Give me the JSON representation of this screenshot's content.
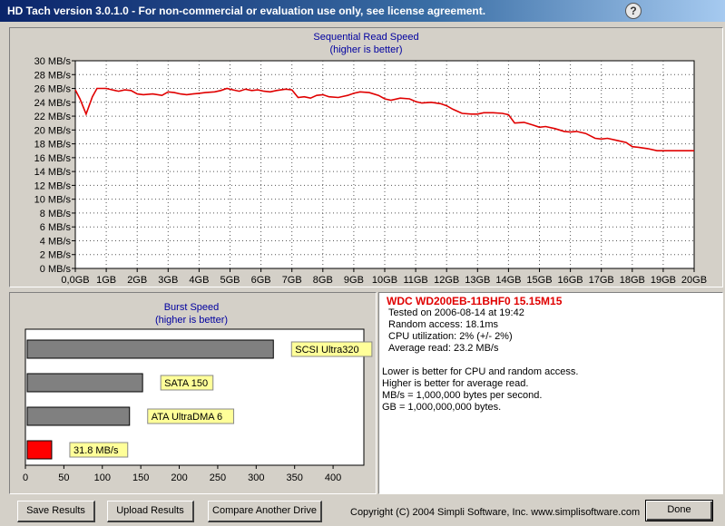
{
  "window": {
    "title": "HD Tach version 3.0.1.0  - For non-commercial or evaluation use only, see license agreement.",
    "icon": "help-icon"
  },
  "sequential": {
    "title": "Sequential Read Speed",
    "subtitle": "(higher is better)"
  },
  "burst": {
    "title": "Burst Speed",
    "subtitle": "(higher is better)"
  },
  "info": {
    "drive": "WDC WD200EB-11BHF0 15.15M15",
    "lines": [
      "Tested on 2006-08-14 at 19:42",
      "Random access: 18.1ms",
      "CPU utilization: 2% (+/- 2%)",
      "Average read: 23.2 MB/s"
    ],
    "notes": [
      "Lower is better for CPU and random access.",
      "Higher is better for average read.",
      "MB/s = 1,000,000 bytes per second.",
      "GB = 1,000,000,000 bytes."
    ]
  },
  "buttons": {
    "save": "Save Results",
    "upload": "Upload Results",
    "compare": "Compare Another Drive",
    "done": "Done"
  },
  "copyright": "Copyright (C) 2004 Simpli Software, Inc. www.simplisoftware.com",
  "colors": {
    "line": "#e00000",
    "bar_reference": "#808080",
    "bar_tested": "#ff0000",
    "label_bg": "#ffff99",
    "panel_title": "#0000a0"
  },
  "chart_data": [
    {
      "type": "line",
      "title": "Sequential Read Speed",
      "subtitle": "(higher is better)",
      "x_ticks": [
        "0,0GB",
        "1GB",
        "2GB",
        "3GB",
        "4GB",
        "5GB",
        "6GB",
        "7GB",
        "8GB",
        "9GB",
        "10GB",
        "11GB",
        "12GB",
        "13GB",
        "14GB",
        "15GB",
        "16GB",
        "17GB",
        "18GB",
        "19GB",
        "20GB"
      ],
      "y_ticks": [
        "0 MB/s",
        "2 MB/s",
        "4 MB/s",
        "6 MB/s",
        "8 MB/s",
        "10 MB/s",
        "12 MB/s",
        "14 MB/s",
        "16 MB/s",
        "18 MB/s",
        "20 MB/s",
        "22 MB/s",
        "24 MB/s",
        "26 MB/s",
        "28 MB/s",
        "30 MB/s"
      ],
      "xlim": [
        0,
        20
      ],
      "ylim": [
        0,
        30
      ],
      "grid": true,
      "series": [
        {
          "x": [
            0,
            0.15,
            0.35,
            0.55,
            0.7,
            1.0,
            1.2,
            1.4,
            1.6,
            1.8,
            2.0,
            2.2,
            2.5,
            2.8,
            3.0,
            3.2,
            3.4,
            3.6,
            3.8,
            4.0,
            4.2,
            4.5,
            4.7,
            4.9,
            5.1,
            5.3,
            5.5,
            5.7,
            5.9,
            6.1,
            6.3,
            6.5,
            6.8,
            7.0,
            7.2,
            7.4,
            7.6,
            7.8,
            8.0,
            8.2,
            8.5,
            8.8,
            9.0,
            9.2,
            9.5,
            9.8,
            10.0,
            10.2,
            10.5,
            10.8,
            11.0,
            11.2,
            11.5,
            11.8,
            12.0,
            12.2,
            12.5,
            12.8,
            13.0,
            13.2,
            13.5,
            13.8,
            14.0,
            14.2,
            14.5,
            14.8,
            15.0,
            15.2,
            15.5,
            15.8,
            16.0,
            16.2,
            16.5,
            16.8,
            17.0,
            17.2,
            17.5,
            17.8,
            18.0,
            18.2,
            18.5,
            18.8,
            19.0,
            19.2,
            19.5,
            19.8,
            20.0
          ],
          "y": [
            25.8,
            24.5,
            22.3,
            24.8,
            26.0,
            26.0,
            25.8,
            25.6,
            25.8,
            25.7,
            25.2,
            25.1,
            25.2,
            25.0,
            25.5,
            25.4,
            25.2,
            25.1,
            25.2,
            25.3,
            25.4,
            25.5,
            25.7,
            26.0,
            25.8,
            25.6,
            25.9,
            25.7,
            25.8,
            25.6,
            25.5,
            25.7,
            25.9,
            25.8,
            24.7,
            24.8,
            24.6,
            25.0,
            25.1,
            24.8,
            24.7,
            25.0,
            25.3,
            25.5,
            25.4,
            25.0,
            24.5,
            24.3,
            24.6,
            24.5,
            24.1,
            23.9,
            24.0,
            23.8,
            23.5,
            23.0,
            22.4,
            22.3,
            22.3,
            22.5,
            22.5,
            22.4,
            22.2,
            21.0,
            21.1,
            20.7,
            20.4,
            20.5,
            20.2,
            19.8,
            19.7,
            19.8,
            19.5,
            18.8,
            18.7,
            18.8,
            18.5,
            18.2,
            17.6,
            17.5,
            17.3,
            17.0,
            17.0,
            17.0,
            17.0,
            17.0,
            17.0
          ]
        }
      ]
    },
    {
      "type": "bar",
      "title": "Burst Speed",
      "subtitle": "(higher is better)",
      "orientation": "horizontal",
      "x_ticks": [
        "0",
        "50",
        "100",
        "150",
        "200",
        "250",
        "300",
        "350",
        "400"
      ],
      "xlim": [
        0,
        440
      ],
      "categories": [
        "SCSI Ultra320",
        "SATA 150",
        "ATA UltraDMA 6",
        "31.8 MB/s"
      ],
      "values": [
        320,
        150,
        133,
        31.8
      ]
    }
  ]
}
